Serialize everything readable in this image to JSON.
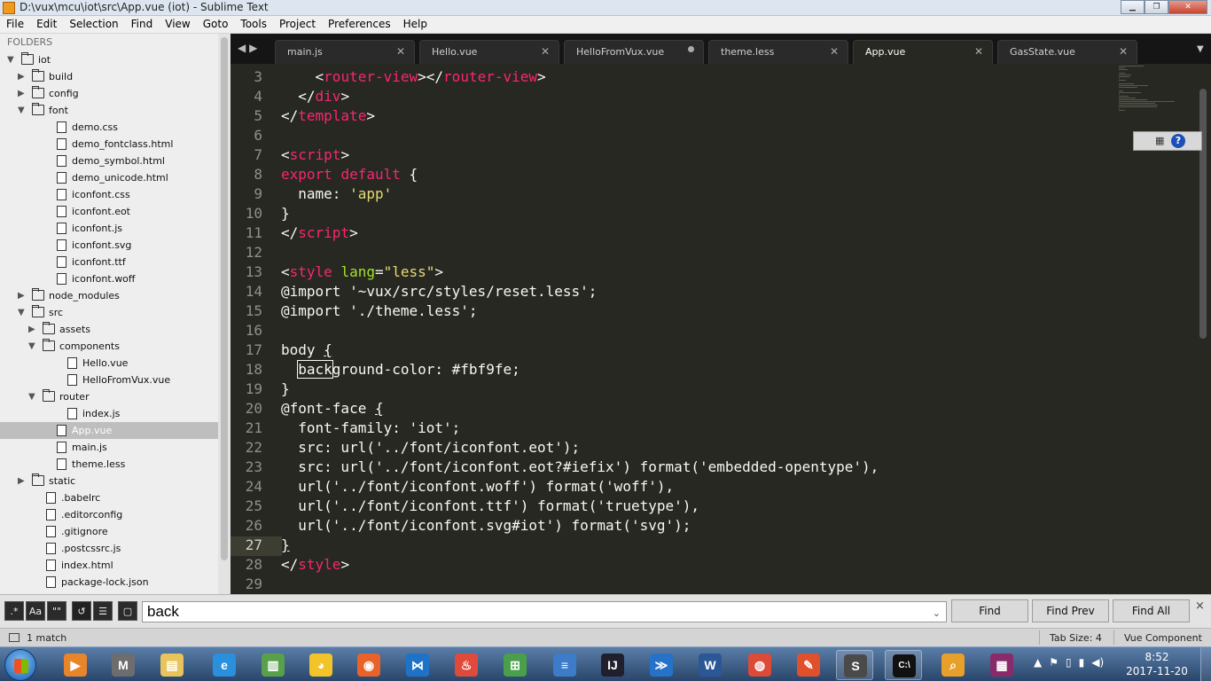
{
  "window": {
    "title": "D:\\vux\\mcu\\iot\\src\\App.vue (iot) - Sublime Text",
    "minimize": "▁",
    "maximize": "❐",
    "close": "✕"
  },
  "menu": [
    "File",
    "Edit",
    "Selection",
    "Find",
    "View",
    "Goto",
    "Tools",
    "Project",
    "Preferences",
    "Help"
  ],
  "sidebar": {
    "header": "FOLDERS",
    "tree": [
      {
        "label": "iot",
        "type": "folder",
        "depth": 0,
        "expanded": true
      },
      {
        "label": "build",
        "type": "folder",
        "depth": 1,
        "expanded": false
      },
      {
        "label": "config",
        "type": "folder",
        "depth": 1,
        "expanded": false
      },
      {
        "label": "font",
        "type": "folder",
        "depth": 1,
        "expanded": true
      },
      {
        "label": "demo.css",
        "type": "file",
        "depth": 2
      },
      {
        "label": "demo_fontclass.html",
        "type": "file",
        "depth": 2
      },
      {
        "label": "demo_symbol.html",
        "type": "file",
        "depth": 2
      },
      {
        "label": "demo_unicode.html",
        "type": "file",
        "depth": 2
      },
      {
        "label": "iconfont.css",
        "type": "file",
        "depth": 2
      },
      {
        "label": "iconfont.eot",
        "type": "file",
        "depth": 2
      },
      {
        "label": "iconfont.js",
        "type": "file",
        "depth": 2
      },
      {
        "label": "iconfont.svg",
        "type": "file",
        "depth": 2
      },
      {
        "label": "iconfont.ttf",
        "type": "file",
        "depth": 2
      },
      {
        "label": "iconfont.woff",
        "type": "file",
        "depth": 2
      },
      {
        "label": "node_modules",
        "type": "folder",
        "depth": 1,
        "expanded": false
      },
      {
        "label": "src",
        "type": "folder",
        "depth": 1,
        "expanded": true
      },
      {
        "label": "assets",
        "type": "folder",
        "depth": 2,
        "expanded": false
      },
      {
        "label": "components",
        "type": "folder",
        "depth": 2,
        "expanded": true
      },
      {
        "label": "Hello.vue",
        "type": "file",
        "depth": 3
      },
      {
        "label": "HelloFromVux.vue",
        "type": "file",
        "depth": 3
      },
      {
        "label": "router",
        "type": "folder",
        "depth": 2,
        "expanded": true
      },
      {
        "label": "index.js",
        "type": "file",
        "depth": 3
      },
      {
        "label": "App.vue",
        "type": "file",
        "depth": 2,
        "selected": true
      },
      {
        "label": "main.js",
        "type": "file",
        "depth": 2
      },
      {
        "label": "theme.less",
        "type": "file",
        "depth": 2
      },
      {
        "label": "static",
        "type": "folder",
        "depth": 1,
        "expanded": false
      },
      {
        "label": ".babelrc",
        "type": "file",
        "depth": 1
      },
      {
        "label": ".editorconfig",
        "type": "file",
        "depth": 1
      },
      {
        "label": ".gitignore",
        "type": "file",
        "depth": 1
      },
      {
        "label": ".postcssrc.js",
        "type": "file",
        "depth": 1
      },
      {
        "label": "index.html",
        "type": "file",
        "depth": 1
      },
      {
        "label": "package-lock.json",
        "type": "file",
        "depth": 1
      }
    ]
  },
  "tabs": [
    {
      "label": "main.js",
      "state": "close"
    },
    {
      "label": "Hello.vue",
      "state": "close"
    },
    {
      "label": "HelloFromVux.vue",
      "state": "dirty"
    },
    {
      "label": "theme.less",
      "state": "close"
    },
    {
      "label": "App.vue",
      "state": "close",
      "active": true
    },
    {
      "label": "GasState.vue",
      "state": "close"
    }
  ],
  "tab_nav": {
    "prev": "◀",
    "next": "▶",
    "overflow": "▼",
    "close_glyph": "✕"
  },
  "editor": {
    "current_line": 27,
    "lines": [
      {
        "n": "3",
        "parts": [
          [
            "p",
            "    <"
          ],
          [
            "t",
            "router-view"
          ],
          [
            "p",
            "></"
          ],
          [
            "t",
            "router-view"
          ],
          [
            "p",
            ">"
          ]
        ]
      },
      {
        "n": "4",
        "parts": [
          [
            "p",
            "  </"
          ],
          [
            "t",
            "div"
          ],
          [
            "p",
            ">"
          ]
        ]
      },
      {
        "n": "5",
        "parts": [
          [
            "p",
            "</"
          ],
          [
            "t",
            "template"
          ],
          [
            "p",
            ">"
          ]
        ]
      },
      {
        "n": "6",
        "parts": []
      },
      {
        "n": "7",
        "parts": [
          [
            "p",
            "<"
          ],
          [
            "t",
            "script"
          ],
          [
            "p",
            ">"
          ]
        ]
      },
      {
        "n": "8",
        "parts": [
          [
            "t",
            "export"
          ],
          [
            "p",
            " "
          ],
          [
            "t",
            "default"
          ],
          [
            "p",
            " {"
          ]
        ]
      },
      {
        "n": "9",
        "parts": [
          [
            "p",
            "  name: "
          ],
          [
            "s",
            "'app'"
          ]
        ]
      },
      {
        "n": "10",
        "parts": [
          [
            "p",
            "}"
          ]
        ]
      },
      {
        "n": "11",
        "parts": [
          [
            "p",
            "</"
          ],
          [
            "t",
            "script"
          ],
          [
            "p",
            ">"
          ]
        ]
      },
      {
        "n": "12",
        "parts": []
      },
      {
        "n": "13",
        "parts": [
          [
            "p",
            "<"
          ],
          [
            "t",
            "style"
          ],
          [
            "p",
            " "
          ],
          [
            "a",
            "lang"
          ],
          [
            "p",
            "="
          ],
          [
            "s",
            "\"less\""
          ],
          [
            "p",
            ">"
          ]
        ]
      },
      {
        "n": "14",
        "parts": [
          [
            "p",
            "@import '~vux/src/styles/reset.less';"
          ]
        ]
      },
      {
        "n": "15",
        "parts": [
          [
            "p",
            "@import './theme.less';"
          ]
        ]
      },
      {
        "n": "16",
        "parts": []
      },
      {
        "n": "17",
        "parts": [
          [
            "p",
            "body "
          ],
          [
            "u",
            "{"
          ]
        ]
      },
      {
        "n": "18",
        "parts": [
          [
            "p",
            "  "
          ],
          [
            "m",
            "back"
          ],
          [
            "p",
            "ground-color: #fbf9fe;"
          ]
        ]
      },
      {
        "n": "19",
        "parts": [
          [
            "p",
            "}"
          ]
        ]
      },
      {
        "n": "20",
        "parts": [
          [
            "p",
            "@font-face "
          ],
          [
            "u",
            "{"
          ]
        ]
      },
      {
        "n": "21",
        "parts": [
          [
            "p",
            "  font-family: 'iot';"
          ]
        ]
      },
      {
        "n": "22",
        "parts": [
          [
            "p",
            "  src: url('../font/iconfont.eot');"
          ]
        ]
      },
      {
        "n": "23",
        "parts": [
          [
            "p",
            "  src: url('../font/iconfont.eot?#iefix') format('embedded-opentype'),"
          ]
        ]
      },
      {
        "n": "24",
        "parts": [
          [
            "p",
            "  url('../font/iconfont.woff') format('woff'),"
          ]
        ]
      },
      {
        "n": "25",
        "parts": [
          [
            "p",
            "  url('../font/iconfont.ttf') format('truetype'),"
          ]
        ]
      },
      {
        "n": "26",
        "parts": [
          [
            "p",
            "  url('../font/iconfont.svg#iot') format('svg');"
          ]
        ]
      },
      {
        "n": "27",
        "parts": [
          [
            "u",
            "}"
          ]
        ]
      },
      {
        "n": "28",
        "parts": [
          [
            "p",
            "</"
          ],
          [
            "t",
            "style"
          ],
          [
            "p",
            ">"
          ]
        ]
      },
      {
        "n": "29",
        "parts": []
      }
    ]
  },
  "find_panel": {
    "options": [
      ".*",
      "Aa",
      "\"\"",
      "↺",
      "☰",
      "▢"
    ],
    "query": "back",
    "dropdown_glyph": "⌄",
    "buttons": [
      "Find",
      "Find Prev",
      "Find All"
    ],
    "close": "×"
  },
  "status": {
    "match": "1 match",
    "tab_size": "Tab Size: 4",
    "syntax": "Vue Component"
  },
  "taskbar": {
    "apps": [
      {
        "name": "media-player",
        "glyph": "▶",
        "color": "#e8852a"
      },
      {
        "name": "mcu-tool",
        "glyph": "M",
        "color": "#6d6d6d"
      },
      {
        "name": "file-explorer",
        "glyph": "▤",
        "color": "#e8c45a"
      },
      {
        "name": "internet-explorer",
        "glyph": "e",
        "color": "#2a8fdc"
      },
      {
        "name": "chart-tool",
        "glyph": "▥",
        "color": "#58a04a"
      },
      {
        "name": "qq",
        "glyph": "◕",
        "color": "#f3c32a"
      },
      {
        "name": "firefox",
        "glyph": "◉",
        "color": "#e8622a"
      },
      {
        "name": "visual-studio",
        "glyph": "⋈",
        "color": "#1e73c8"
      },
      {
        "name": "swift-tool",
        "glyph": "♨",
        "color": "#e04a3a"
      },
      {
        "name": "network-tool",
        "glyph": "⊞",
        "color": "#4aa04a"
      },
      {
        "name": "editor-app",
        "glyph": "≡",
        "color": "#3c7cc8"
      },
      {
        "name": "intellij",
        "glyph": "IJ",
        "color": "#1f1f2e"
      },
      {
        "name": "powershell",
        "glyph": "≫",
        "color": "#2672c8"
      },
      {
        "name": "word",
        "glyph": "W",
        "color": "#2b5797"
      },
      {
        "name": "chrome",
        "glyph": "◍",
        "color": "#dc4a38"
      },
      {
        "name": "tool-app",
        "glyph": "✎",
        "color": "#e0502a"
      },
      {
        "name": "sublime-text",
        "glyph": "S",
        "color": "#4a4a4a",
        "running": true
      },
      {
        "name": "command-prompt",
        "glyph": "C:\\",
        "color": "#111111",
        "running": true
      },
      {
        "name": "search-tool",
        "glyph": "⌕",
        "color": "#e8a02a"
      },
      {
        "name": "winrar",
        "glyph": "▦",
        "color": "#8a2a6a"
      }
    ],
    "tray": [
      "▲",
      "⚑",
      "▯",
      "▮",
      "◀)"
    ],
    "time": "8:52",
    "date": "2017-11-20"
  },
  "tray_widget": {
    "keyboard": "▦",
    "help": "?"
  },
  "colors": {
    "editor_bg": "#272822",
    "tag": "#f92672",
    "string": "#e6db74",
    "attribute": "#a6e22e",
    "text": "#f8f8f2"
  }
}
